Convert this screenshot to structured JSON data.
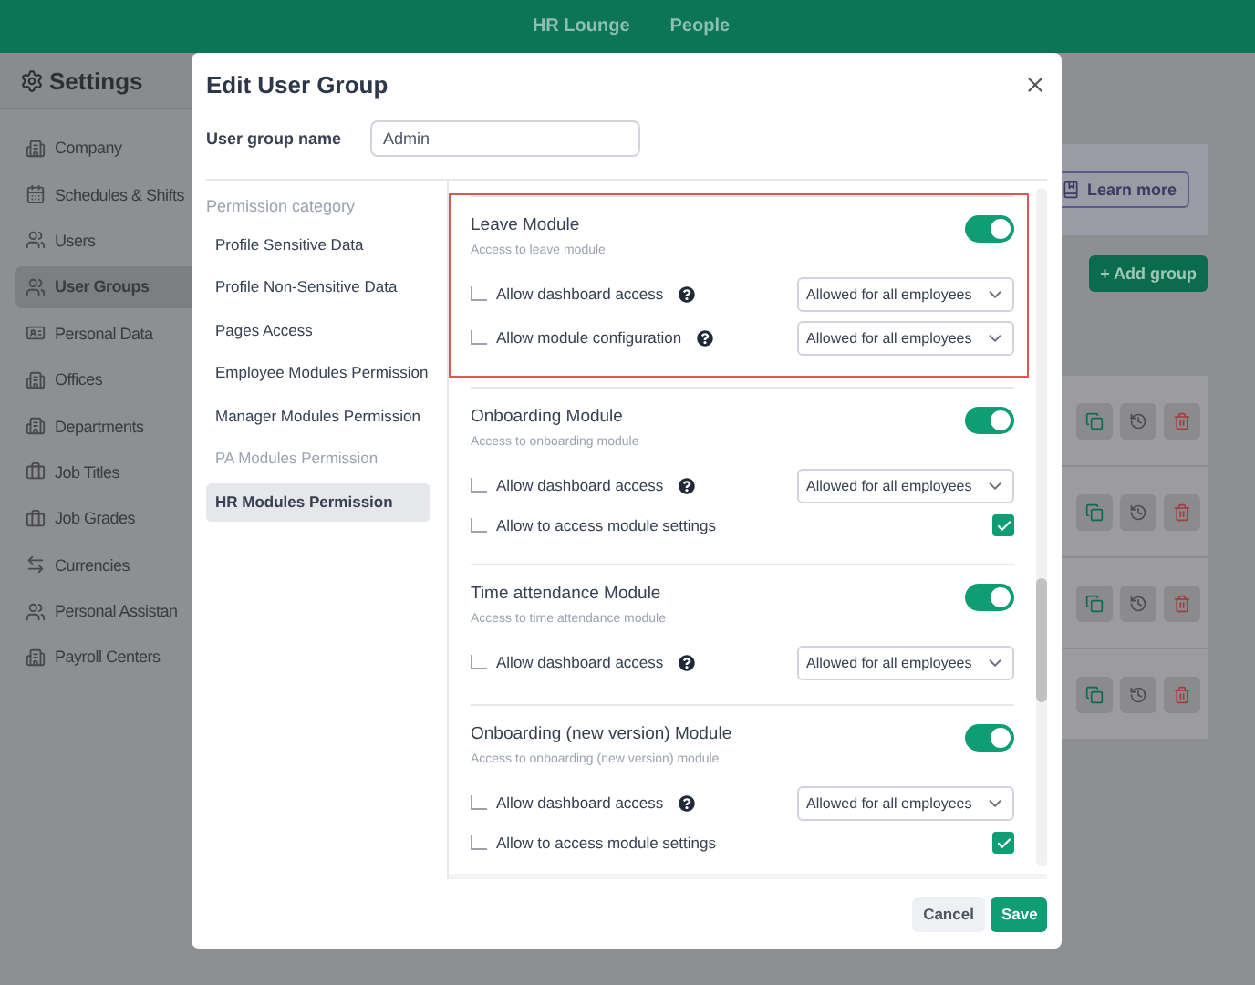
{
  "top_nav": [
    "HR Lounge",
    "People"
  ],
  "settings": {
    "title": "Settings",
    "items": [
      {
        "label": "Company",
        "selected": false
      },
      {
        "label": "Schedules & Shifts",
        "selected": false
      },
      {
        "label": "Users",
        "selected": false
      },
      {
        "label": "User Groups",
        "selected": true
      },
      {
        "label": "Personal Data",
        "selected": false
      },
      {
        "label": "Offices",
        "selected": false
      },
      {
        "label": "Departments",
        "selected": false
      },
      {
        "label": "Job Titles",
        "selected": false
      },
      {
        "label": "Job Grades",
        "selected": false
      },
      {
        "label": "Currencies",
        "selected": false
      },
      {
        "label": "Personal Assistan",
        "selected": false
      },
      {
        "label": "Payroll Centers",
        "selected": false
      }
    ]
  },
  "page": {
    "learn_more": "Learn more",
    "add_group": "+ Add group"
  },
  "dialog": {
    "title": "Edit User Group",
    "name_label": "User group name",
    "name_value": "Admin",
    "category_heading": "Permission category",
    "categories": [
      {
        "label": "Profile Sensitive Data",
        "selected": false,
        "disabled": false
      },
      {
        "label": "Profile Non-Sensitive Data",
        "selected": false,
        "disabled": false
      },
      {
        "label": "Pages Access",
        "selected": false,
        "disabled": false
      },
      {
        "label": "Employee Modules Permission",
        "selected": false,
        "disabled": false
      },
      {
        "label": "Manager Modules Permission",
        "selected": false,
        "disabled": false
      },
      {
        "label": "PA Modules Permission",
        "selected": false,
        "disabled": true
      },
      {
        "label": "HR Modules Permission",
        "selected": true,
        "disabled": false
      }
    ],
    "modules": [
      {
        "title": "Leave Module",
        "subtitle": "Access to leave module",
        "enabled": true,
        "highlighted": true,
        "rows": [
          {
            "kind": "select",
            "label": "Allow dashboard access",
            "help": true,
            "value": "Allowed for all employees"
          },
          {
            "kind": "select",
            "label": "Allow module configuration",
            "help": true,
            "value": "Allowed for all employees"
          }
        ]
      },
      {
        "title": "Onboarding Module",
        "subtitle": "Access to onboarding module",
        "enabled": true,
        "highlighted": false,
        "rows": [
          {
            "kind": "select",
            "label": "Allow dashboard access",
            "help": true,
            "value": "Allowed for all employees"
          },
          {
            "kind": "checkbox",
            "label": "Allow to access module settings",
            "checked": true
          }
        ]
      },
      {
        "title": "Time attendance Module",
        "subtitle": "Access to time attendance module",
        "enabled": true,
        "highlighted": false,
        "rows": [
          {
            "kind": "select",
            "label": "Allow dashboard access",
            "help": true,
            "value": "Allowed for all employees"
          }
        ]
      },
      {
        "title": "Onboarding (new version) Module",
        "subtitle": "Access to onboarding (new version) module",
        "enabled": true,
        "highlighted": false,
        "rows": [
          {
            "kind": "select",
            "label": "Allow dashboard access",
            "help": true,
            "value": "Allowed for all employees"
          },
          {
            "kind": "checkbox",
            "label": "Allow to access module settings",
            "checked": true
          }
        ]
      }
    ],
    "buttons": {
      "cancel": "Cancel",
      "save": "Save"
    }
  }
}
